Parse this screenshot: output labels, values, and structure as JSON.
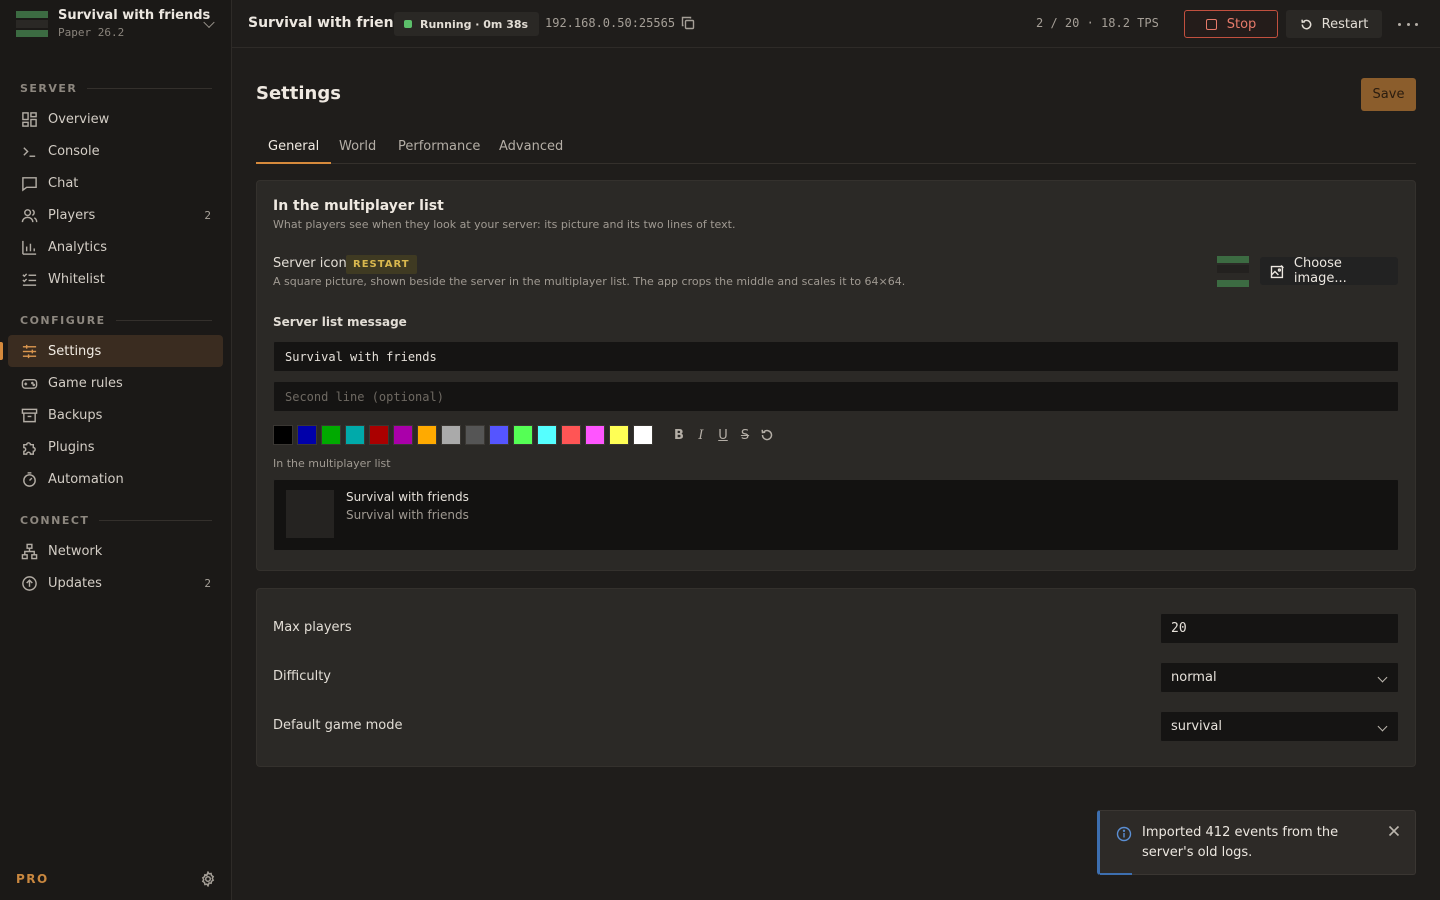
{
  "server": {
    "name": "Survival with friends",
    "version": "Paper 26.2"
  },
  "sidebar": {
    "sections": [
      {
        "label": "SERVER"
      },
      {
        "label": "CONFIGURE"
      },
      {
        "label": "CONNECT"
      }
    ],
    "items": [
      {
        "label": "Overview",
        "icon": "overview-icon"
      },
      {
        "label": "Console",
        "icon": "terminal-icon"
      },
      {
        "label": "Chat",
        "icon": "chat-icon"
      },
      {
        "label": "Players",
        "icon": "users-icon",
        "count": "2"
      },
      {
        "label": "Analytics",
        "icon": "bar-chart-icon"
      },
      {
        "label": "Whitelist",
        "icon": "checklist-icon"
      },
      {
        "label": "Settings",
        "icon": "sliders-icon",
        "active": true
      },
      {
        "label": "Game rules",
        "icon": "gamepad-icon"
      },
      {
        "label": "Backups",
        "icon": "archive-icon"
      },
      {
        "label": "Plugins",
        "icon": "puzzle-icon"
      },
      {
        "label": "Automation",
        "icon": "timer-icon"
      },
      {
        "label": "Network",
        "icon": "network-icon"
      },
      {
        "label": "Updates",
        "icon": "upload-circle-icon",
        "count": "2"
      }
    ],
    "plan_label": "PRO"
  },
  "topbar": {
    "title": "Survival with friends",
    "status": "Running · 0m 38s",
    "address": "192.168.0.50:25565",
    "stats": "2 / 20 · 18.2 TPS",
    "stop_label": "Stop",
    "restart_label": "Restart"
  },
  "page": {
    "title": "Settings",
    "save_label": "Save",
    "tabs": [
      "General",
      "World",
      "Performance",
      "Advanced"
    ],
    "active_tab": "General"
  },
  "multiplayer_card": {
    "title": "In the multiplayer list",
    "subtitle": "What players see when they look at your server: its picture and its two lines of text.",
    "server_icon_label": "Server icon",
    "restart_badge": "RESTART",
    "server_icon_help": "A square picture, shown beside the server in the multiplayer list. The app crops the middle and scales it to 64×64.",
    "choose_image_label": "Choose image...",
    "message_label": "Server list message",
    "line1_value": "Survival with friends",
    "line2_placeholder": "Second line (optional)",
    "colors": [
      "#000000",
      "#0000aa",
      "#00aa00",
      "#00aaaa",
      "#aa0000",
      "#aa00aa",
      "#ffaa00",
      "#aaaaaa",
      "#555555",
      "#5555ff",
      "#55ff55",
      "#55ffff",
      "#ff5555",
      "#ff55ff",
      "#ffff55",
      "#ffffff"
    ],
    "format_buttons": [
      "B",
      "I",
      "U",
      "S"
    ],
    "preview_label": "In the multiplayer list",
    "preview_line1": "Survival with friends",
    "preview_line2": "Survival with friends"
  },
  "game_card": {
    "max_players_label": "Max players",
    "max_players_value": "20",
    "difficulty_label": "Difficulty",
    "difficulty_value": "normal",
    "gamemode_label": "Default game mode",
    "gamemode_value": "survival"
  },
  "toast": {
    "message": "Imported 412 events from the server's old logs."
  },
  "colors": {
    "accent": "#d68a3c",
    "running": "#5cbf6a",
    "stop": "#e67a6a",
    "info": "#3d6fb0",
    "badge": "#d9b84e"
  }
}
